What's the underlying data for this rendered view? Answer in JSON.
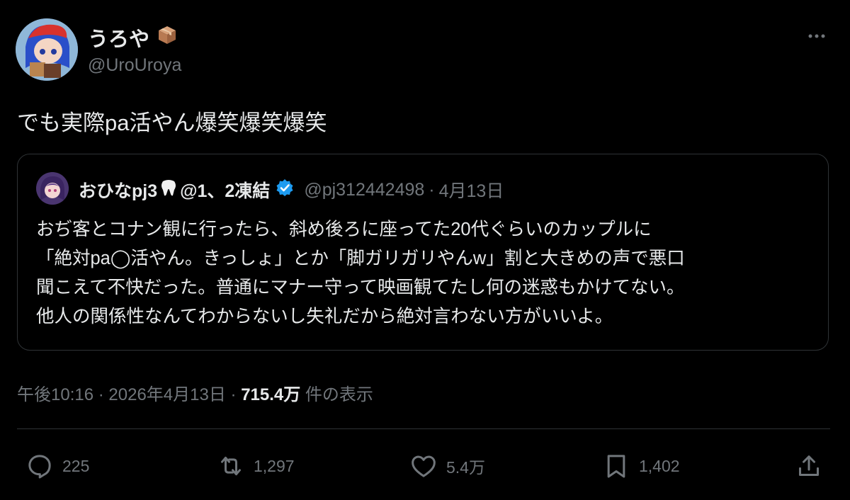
{
  "author": {
    "name": "うろや",
    "handle": "@UroUroya"
  },
  "tweet": {
    "text": "でも実際pa活やん爆笑爆笑爆笑"
  },
  "quote": {
    "name": "おひなpj3",
    "name_suffix": "@1、2凍結",
    "handle": "@pj312442498",
    "separator": "·",
    "date": "4月13日",
    "lines": [
      "おぢ客とコナン観に行ったら、斜め後ろに座ってた20代ぐらいのカップルに",
      "「絶対pa◯活やん。きっしょ」とか「脚ガリガリやんw」割と大きめの声で悪口",
      "聞こえて不快だった。普通にマナー守って映画観てたし何の迷惑もかけてない。",
      "他人の関係性なんてわからないし失礼だから絶対言わない方がいいよ。"
    ]
  },
  "meta": {
    "time": "午後10:16",
    "dot1": "·",
    "date": "2026年4月13日",
    "dot2": "·",
    "views": "715.4万",
    "views_label": "件の表示"
  },
  "actions": {
    "replies": "225",
    "reposts": "1,297",
    "likes": "5.4万",
    "bookmarks": "1,402"
  },
  "colors": {
    "background": "#000000",
    "text": "#e7e9ea",
    "muted": "#71767b",
    "verified": "#1d9bf0"
  }
}
